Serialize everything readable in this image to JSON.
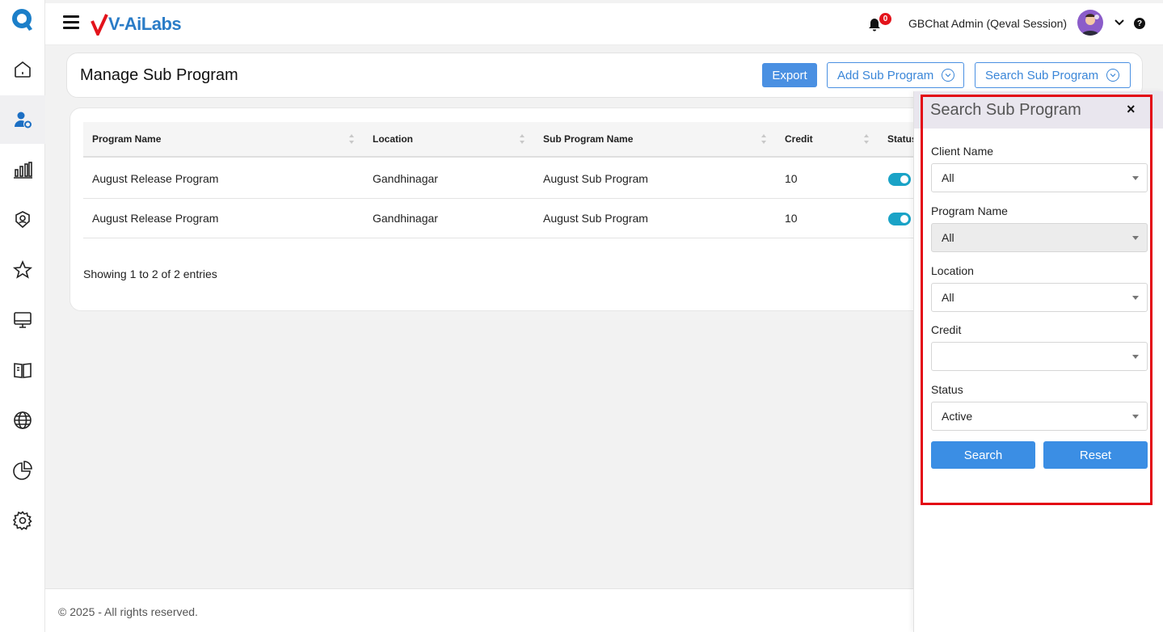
{
  "header": {
    "brand": "V-AiLabs",
    "notification_count": "0",
    "user_name": "GBChat Admin (Qeval Session)",
    "help": "?"
  },
  "sidebar": {
    "items": [
      {
        "icon": "home-icon"
      },
      {
        "icon": "user-settings-icon"
      },
      {
        "icon": "bar-chart-icon"
      },
      {
        "icon": "badge-icon"
      },
      {
        "icon": "star-icon"
      },
      {
        "icon": "monitor-icon"
      },
      {
        "icon": "book-icon"
      },
      {
        "icon": "globe-icon"
      },
      {
        "icon": "pie-chart-icon"
      },
      {
        "icon": "gear-icon"
      }
    ]
  },
  "page": {
    "title": "Manage Sub Program",
    "export_label": "Export",
    "add_label": "Add Sub Program",
    "search_label": "Search Sub Program"
  },
  "table": {
    "columns": [
      "Program Name",
      "Location",
      "Sub Program Name",
      "Credit",
      "Status"
    ],
    "rows": [
      {
        "program": "August Release Program",
        "location": "Gandhinagar",
        "sub_program": "August Sub Program",
        "credit": "10",
        "status": true
      },
      {
        "program": "August Release Program",
        "location": "Gandhinagar",
        "sub_program": "August Sub Program",
        "credit": "10",
        "status": true
      }
    ],
    "showing": "Showing 1 to 2 of 2 entries"
  },
  "footer": {
    "text": "© 2025 - All rights reserved."
  },
  "search_panel": {
    "title": "Search Sub Program",
    "close": "×",
    "client_name_label": "Client Name",
    "client_name_value": "All",
    "program_name_label": "Program Name",
    "program_name_value": "All",
    "location_label": "Location",
    "location_value": "All",
    "credit_label": "Credit",
    "credit_value": "",
    "status_label": "Status",
    "status_value": "Active",
    "search_button": "Search",
    "reset_button": "Reset"
  },
  "colors": {
    "primary": "#4a90e2",
    "toggle": "#1aa3c7",
    "highlight": "#e30613",
    "badge": "#e3131b"
  }
}
